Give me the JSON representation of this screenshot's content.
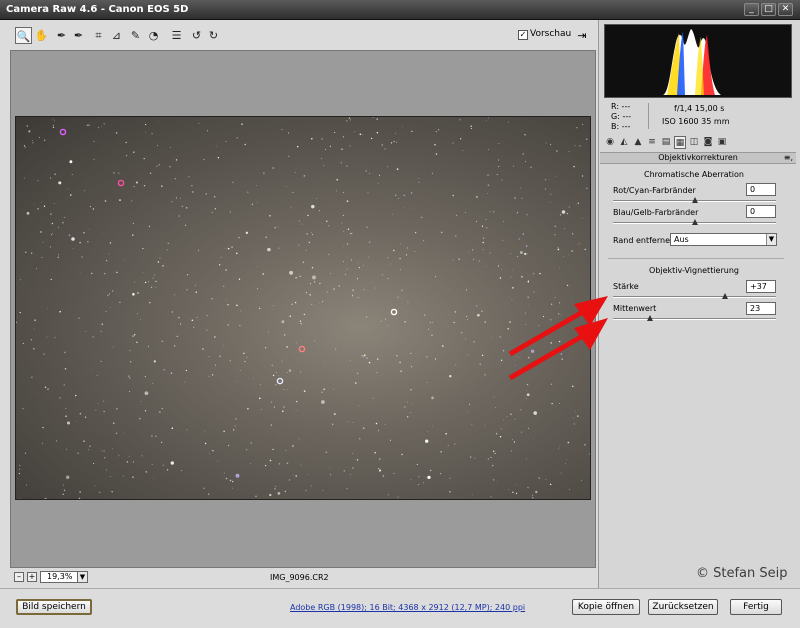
{
  "window": {
    "title": "Camera Raw 4.6 - Canon EOS 5D",
    "controls": [
      "_",
      "□",
      "✕"
    ]
  },
  "toolbar": {
    "tools": [
      {
        "name": "zoom-tool",
        "icon": "🔍",
        "active": true
      },
      {
        "name": "hand-tool",
        "icon": "✋"
      },
      {
        "name": "white-balance-tool",
        "icon": "✒"
      },
      {
        "name": "color-sampler-tool",
        "icon": "✒"
      },
      {
        "name": "crop-tool",
        "icon": "⌗"
      },
      {
        "name": "straighten-tool",
        "icon": "⊿"
      },
      {
        "name": "retouch-tool",
        "icon": "✎"
      },
      {
        "name": "red-eye-tool",
        "icon": "◔"
      },
      {
        "name": "preferences-tool",
        "icon": "☰"
      },
      {
        "name": "rotate-left-tool",
        "icon": "↺"
      },
      {
        "name": "rotate-right-tool",
        "icon": "↻"
      }
    ],
    "preview_label": "Vorschau",
    "preview_checked": "✓",
    "fullscreen_icon": "⇥"
  },
  "status": {
    "zoom_out": "–",
    "zoom_in": "+",
    "zoom_value": "19,3%",
    "zoom_arrow": "▼",
    "filename": "IMG_9096.CR2"
  },
  "readout": {
    "r": "R:  ---",
    "g": "G:  ---",
    "b": "B:  ---",
    "aperture_shutter": "f/1,4    15,00 s",
    "iso_focal": "ISO 1600    35 mm"
  },
  "panel_tabs": [
    "◉",
    "◭",
    "▲",
    "≡",
    "▤",
    "▦",
    "◫",
    "◙",
    "▣"
  ],
  "panel": {
    "section_title": "Objektivkorrekturen",
    "section_menu": "≡,",
    "ca": {
      "title": "Chromatische Aberration",
      "red_cyan_label": "Rot/Cyan-Farbränder",
      "red_cyan_value": "0",
      "red_cyan_pos": 0.5,
      "blue_yellow_label": "Blau/Gelb-Farbränder",
      "blue_yellow_value": "0",
      "blue_yellow_pos": 0.5,
      "fringe_label": "Rand entfernen:",
      "fringe_value": "Aus",
      "fringe_arrow": "▼"
    },
    "vignette": {
      "title": "Objektiv-Vignettierung",
      "amount_label": "Stärke",
      "amount_value": "+37",
      "amount_pos": 0.685,
      "midpoint_label": "Mittenwert",
      "midpoint_value": "23",
      "midpoint_pos": 0.23
    }
  },
  "footer": {
    "save_label": "Bild speichern",
    "workflow_link": "Adobe RGB (1998); 16 Bit; 4368 x 2912 (12,7 MP); 240 ppi",
    "open_copy_label": "Kopie öffnen",
    "reset_label": "Zurücksetzen",
    "done_label": "Fertig"
  },
  "copyright": "© Stefan Seip",
  "colors": {
    "arrow": "#e81010",
    "accent_border": "#7a6a3a",
    "link": "#1a33a8"
  }
}
